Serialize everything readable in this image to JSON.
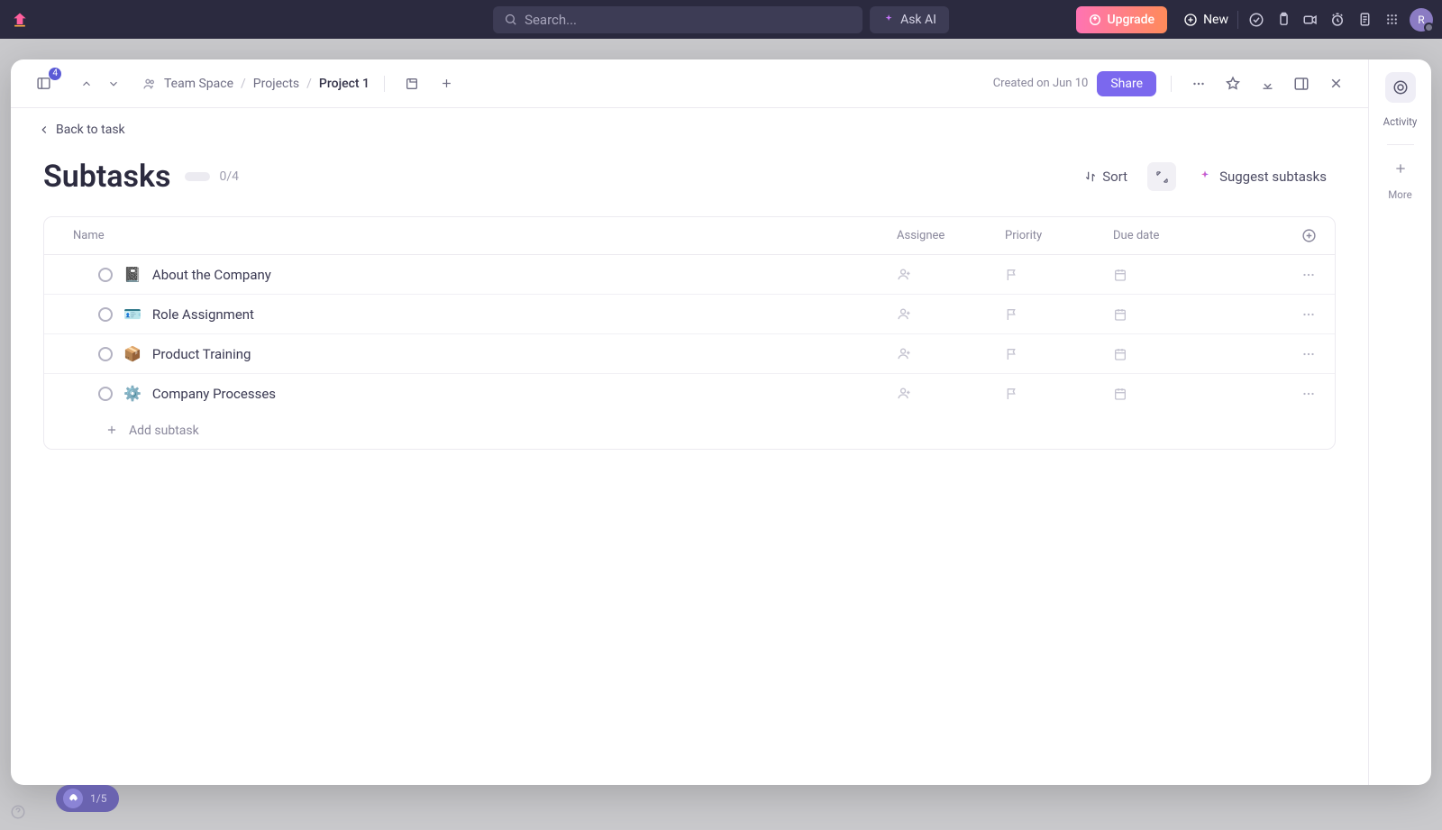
{
  "topbar": {
    "search_placeholder": "Search...",
    "ask_ai_label": "Ask AI",
    "upgrade_label": "Upgrade",
    "new_label": "New",
    "avatar_initial": "R"
  },
  "modal": {
    "sidebar_badge": "4",
    "breadcrumbs": {
      "space": "Team Space",
      "middle": "Projects",
      "last": "Project 1"
    },
    "created": "Created on Jun 10",
    "share_label": "Share",
    "back_label": "Back to task",
    "title": "Subtasks",
    "progress": "0/4",
    "sort_label": "Sort",
    "suggest_label": "Suggest subtasks",
    "columns": {
      "name": "Name",
      "assignee": "Assignee",
      "priority": "Priority",
      "due": "Due date"
    },
    "subtasks": [
      {
        "emoji": "📓",
        "name": "About the Company"
      },
      {
        "emoji": "🪪",
        "name": "Role Assignment"
      },
      {
        "emoji": "📦",
        "name": "Product Training"
      },
      {
        "emoji": "⚙️",
        "name": "Company Processes"
      }
    ],
    "add_subtask_label": "Add subtask",
    "side": {
      "activity_label": "Activity",
      "more_label": "More"
    }
  },
  "tour": {
    "progress": "1/5"
  }
}
